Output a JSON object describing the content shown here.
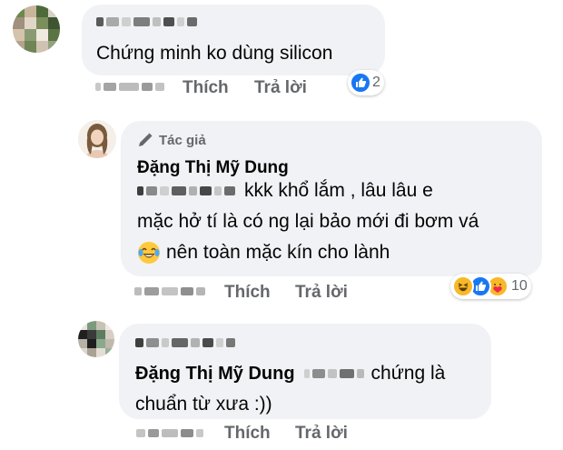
{
  "comments": [
    {
      "text": "Chứng minh ko dùng silicon",
      "actions": {
        "like": "Thích",
        "reply": "Trả lời"
      },
      "reaction_count": "2",
      "reactions": [
        "like-icon"
      ]
    },
    {
      "author_badge": "Tác giả",
      "author_badge_icon": "pencil-icon",
      "author": "Đặng Thị Mỹ Dung",
      "text_line1": "kkk khổ lắm , lâu lâu e",
      "text_line2": "mặc hở tí là có ng lại bảo mới đi bơm vá",
      "text_line3": "nên toàn mặc kín cho lành",
      "emoji": "face-with-tears-of-joy-icon",
      "actions": {
        "like": "Thích",
        "reply": "Trả lời"
      },
      "reaction_count": "10",
      "reactions": [
        "haha-icon",
        "like-icon",
        "care-icon"
      ]
    },
    {
      "mention": "Đặng Thị Mỹ Dung",
      "text_line1": "chứng là",
      "text_line2": "chuẩn từ xưa :))",
      "actions": {
        "like": "Thích",
        "reply": "Trả lời"
      }
    }
  ],
  "colors": {
    "bubble": "#f0f2f5",
    "secondary_text": "#65676b",
    "like_blue": "#1877f2",
    "haha_yellow": "#f7b928"
  }
}
